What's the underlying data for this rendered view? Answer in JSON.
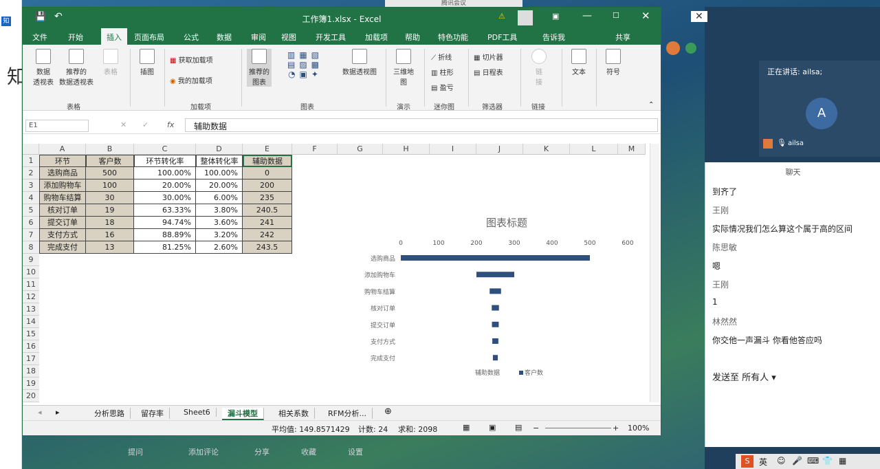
{
  "meeting_app": {
    "title": "腾讯会议"
  },
  "excel": {
    "title": "工作簿1.xlsx  -  Excel",
    "tabs": [
      "文件",
      "开始",
      "插入",
      "页面布局",
      "公式",
      "数据",
      "审阅",
      "视图",
      "开发工具",
      "加载项",
      "帮助",
      "特色功能",
      "PDF工具",
      "告诉我",
      "共享"
    ],
    "active_tab": "插入",
    "ribbon": {
      "pivot_table": "数据\n透视表",
      "recommended_pivot": "推荐的\n数据透视表",
      "table": "表格",
      "illustrations": "插图",
      "get_addins": "获取加载项",
      "my_addins": "我的加载项",
      "group_tables": "表格",
      "group_addins": "加载项",
      "recommended_charts": "推荐的\n图表",
      "pivot_chart": "数据透视图",
      "group_charts": "图表",
      "map3d": "三维地\n图",
      "group_tours": "演示",
      "line": "折线",
      "column": "柱形",
      "winloss": "盈亏",
      "group_sparklines": "迷你图",
      "slicer": "切片器",
      "timeline": "日程表",
      "group_filters": "筛选器",
      "link": "链\n接",
      "group_links": "链接",
      "text": "文本",
      "symbol": "符号"
    },
    "name_box": "E1",
    "formula": "辅助数据",
    "columns": [
      "A",
      "B",
      "C",
      "D",
      "E",
      "F",
      "G",
      "H",
      "I",
      "J",
      "K",
      "L",
      "M"
    ],
    "rows": [
      "1",
      "2",
      "3",
      "4",
      "5",
      "6",
      "7",
      "8",
      "9",
      "10",
      "11",
      "12",
      "13",
      "14",
      "15",
      "16",
      "17",
      "18",
      "19",
      "20"
    ],
    "table": {
      "headers": [
        "环节",
        "客户数",
        "环节转化率",
        "整体转化率",
        "辅助数据"
      ],
      "rows": [
        [
          "选购商品",
          "500",
          "100.00%",
          "100.00%",
          "0"
        ],
        [
          "添加购物车",
          "100",
          "20.00%",
          "20.00%",
          "200"
        ],
        [
          "购物车结算",
          "30",
          "30.00%",
          "6.00%",
          "235"
        ],
        [
          "核对订单",
          "19",
          "63.33%",
          "3.80%",
          "240.5"
        ],
        [
          "提交订单",
          "18",
          "94.74%",
          "3.60%",
          "241"
        ],
        [
          "支付方式",
          "16",
          "88.89%",
          "3.20%",
          "242"
        ],
        [
          "完成支付",
          "13",
          "81.25%",
          "2.60%",
          "243.5"
        ]
      ]
    },
    "sheet_tabs": [
      "分析思路",
      "留存率",
      "Sheet6",
      "漏斗模型",
      "相关系数",
      "RFM分析..."
    ],
    "active_sheet": "漏斗模型",
    "status": {
      "average": "平均值: 149.8571429",
      "count": "计数: 24",
      "sum": "求和: 2098",
      "zoom": "100%"
    }
  },
  "chart_data": {
    "type": "bar",
    "title": "图表标题",
    "categories": [
      "选购商品",
      "添加购物车",
      "购物车结算",
      "核对订单",
      "提交订单",
      "支付方式",
      "完成支付"
    ],
    "series": [
      {
        "name": "辅助数据",
        "values": [
          0,
          200,
          235,
          240.5,
          241,
          242,
          243.5
        ],
        "color": "transparent"
      },
      {
        "name": "客户数",
        "values": [
          500,
          100,
          30,
          19,
          18,
          16,
          13
        ],
        "color": "#2f4f7f"
      }
    ],
    "stacked": true,
    "xticks": [
      "0",
      "100",
      "200",
      "300",
      "400",
      "500",
      "600"
    ],
    "xlim": [
      0,
      600
    ],
    "legend": "bottom"
  },
  "meeting": {
    "speaking": "正在讲话: ailsa;",
    "avatar_letter": "A",
    "user": "ailsa",
    "chat_title": "聊天",
    "messages": [
      {
        "text": "到齐了"
      },
      {
        "name": "王刚"
      },
      {
        "text": "实际情况我们怎么算这个属于高的区间"
      },
      {
        "name": "陈思敏"
      },
      {
        "text": "嗯"
      },
      {
        "name": "王刚"
      },
      {
        "text": "1"
      },
      {
        "name": "林然然"
      },
      {
        "text": "你交他一声漏斗 你看他答应吗"
      }
    ],
    "send_to": "发送至 所有人"
  },
  "bottom_bar": [
    "提问",
    "添加评论",
    "分享",
    "收藏",
    "设置"
  ],
  "taskbar": {
    "ime": "英"
  }
}
